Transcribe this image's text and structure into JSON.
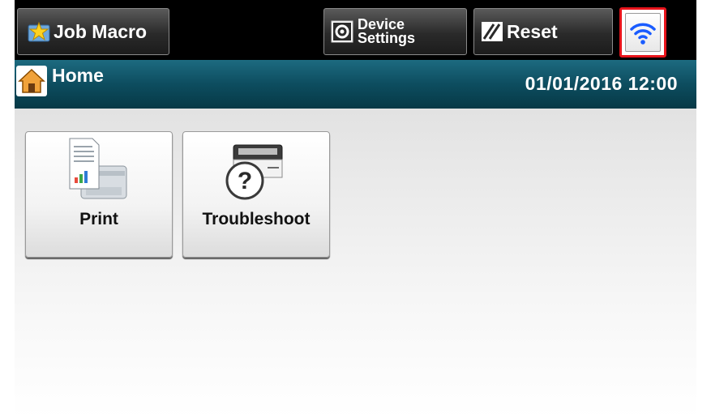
{
  "topbar": {
    "job_macro_label": "Job Macro",
    "device_settings_line1": "Device",
    "device_settings_line2": "Settings",
    "reset_label": "Reset"
  },
  "status": {
    "screen_title": "Home",
    "datetime": "01/01/2016 12:00"
  },
  "tiles": [
    {
      "label": "Print",
      "icon": "print-icon"
    },
    {
      "label": "Troubleshoot",
      "icon": "troubleshoot-icon"
    }
  ],
  "colors": {
    "topbar": "#000000",
    "statusbar": "#0d4d5f",
    "wifi_highlight": "#e8141b",
    "wifi_icon": "#1a5cff"
  }
}
